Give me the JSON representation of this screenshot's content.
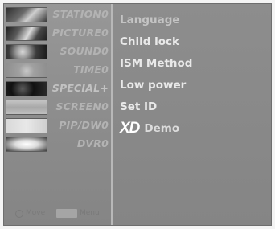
{
  "menu": {
    "items": [
      {
        "label": "STATION0"
      },
      {
        "label": "PICTURE0"
      },
      {
        "label": "SOUND0"
      },
      {
        "label": "TIME0"
      },
      {
        "label": "SPECIAL+"
      },
      {
        "label": "SCREEN0"
      },
      {
        "label": "PIP/DW0"
      },
      {
        "label": "DVR0"
      }
    ]
  },
  "footer": {
    "move_label": "Move",
    "menu_label": "Menu"
  },
  "options": {
    "language": "Language",
    "child_lock": "Child lock",
    "ism_method": "ISM Method",
    "low_power": "Low power",
    "set_id": "Set ID",
    "xd_logo": "XD",
    "xd_demo": "Demo"
  },
  "colors": {
    "background": "#8a8a8a",
    "option_text": "#e9e9e9",
    "menu_text": "#b3b3b3"
  }
}
